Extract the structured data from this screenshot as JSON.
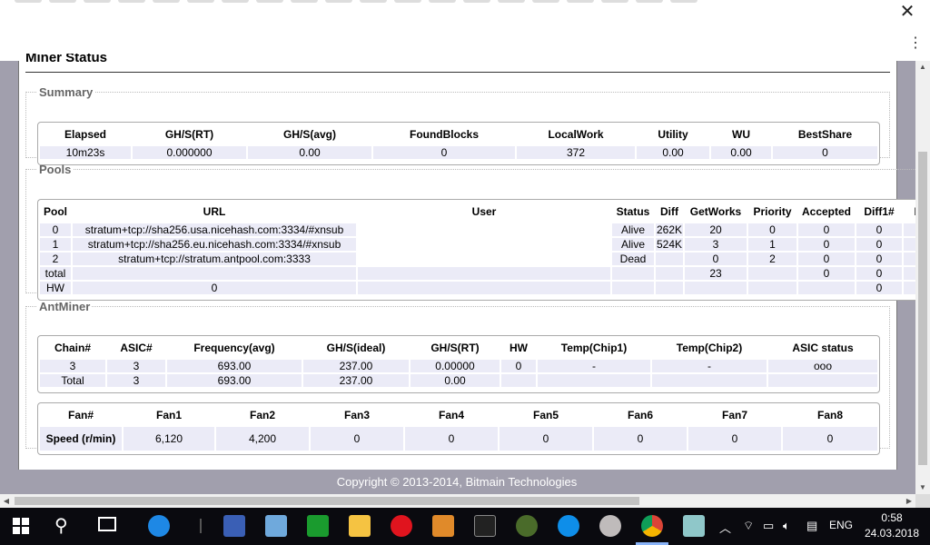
{
  "browser": {
    "close_icon": "close-icon",
    "menu_icon": "kebab-menu-icon"
  },
  "page": {
    "title": "Miner Status",
    "footer": "Copyright © 2013-2014, Bitmain Technologies"
  },
  "summary": {
    "legend": "Summary",
    "headers": [
      "Elapsed",
      "GH/S(RT)",
      "GH/S(avg)",
      "FoundBlocks",
      "LocalWork",
      "Utility",
      "WU",
      "BestShare"
    ],
    "row": [
      "10m23s",
      "0.000000",
      "0.00",
      "0",
      "372",
      "0.00",
      "0.00",
      "0"
    ]
  },
  "pools": {
    "legend": "Pools",
    "headers": [
      "Pool",
      "URL",
      "User",
      "Status",
      "Diff",
      "GetWorks",
      "Priority",
      "Accepted",
      "Diff1#",
      "Di"
    ],
    "rows": [
      [
        "0",
        "stratum+tcp://sha256.usa.nicehash.com:3334/#xnsub",
        "",
        "Alive",
        "262K",
        "20",
        "0",
        "0",
        "0",
        ""
      ],
      [
        "1",
        "stratum+tcp://sha256.eu.nicehash.com:3334/#xnsub",
        "",
        "Alive",
        "524K",
        "3",
        "1",
        "0",
        "0",
        ""
      ],
      [
        "2",
        "stratum+tcp://stratum.antpool.com:3333",
        "",
        "Dead",
        "",
        "0",
        "2",
        "0",
        "0",
        ""
      ],
      [
        "total",
        "",
        "",
        "",
        "",
        "23",
        "",
        "0",
        "0",
        ""
      ],
      [
        "HW",
        "0",
        "",
        "",
        "",
        "",
        "",
        "",
        "0",
        ""
      ]
    ]
  },
  "antminer": {
    "legend": "AntMiner",
    "headers": [
      "Chain#",
      "ASIC#",
      "Frequency(avg)",
      "GH/S(ideal)",
      "GH/S(RT)",
      "HW",
      "Temp(Chip1)",
      "Temp(Chip2)",
      "ASIC status"
    ],
    "rows": [
      [
        "3",
        "3",
        "693.00",
        "237.00",
        "0.00000",
        "0",
        "-",
        "-",
        "ooo"
      ],
      [
        "Total",
        "3",
        "693.00",
        "237.00",
        "0.00",
        "",
        "",
        "",
        ""
      ]
    ],
    "fan_headers": [
      "Fan#",
      "Fan1",
      "Fan2",
      "Fan3",
      "Fan4",
      "Fan5",
      "Fan6",
      "Fan7",
      "Fan8"
    ],
    "fan_row": [
      "Speed (r/min)",
      "6,120",
      "4,200",
      "0",
      "0",
      "0",
      "0",
      "0",
      "0"
    ]
  },
  "taskbar": {
    "icons": [
      "windows-start-icon",
      "search-icon",
      "task-view-icon",
      "search-app-icon",
      "save-floppy-icon",
      "calculator-icon",
      "torrent-icon",
      "folder-icon",
      "opera-icon",
      "media-player-icon",
      "command-prompt-icon",
      "cannabis-app-icon",
      "teamviewer-icon",
      "litecoin-icon",
      "chrome-icon",
      "tablet-app-icon"
    ],
    "colors": {
      "chrome": "#4285f4",
      "opera": "#e0141e",
      "folder": "#f5c342",
      "torrent": "#1a9b2e"
    },
    "lang": "ENG",
    "time": "0:58",
    "date": "24.03.2018"
  }
}
